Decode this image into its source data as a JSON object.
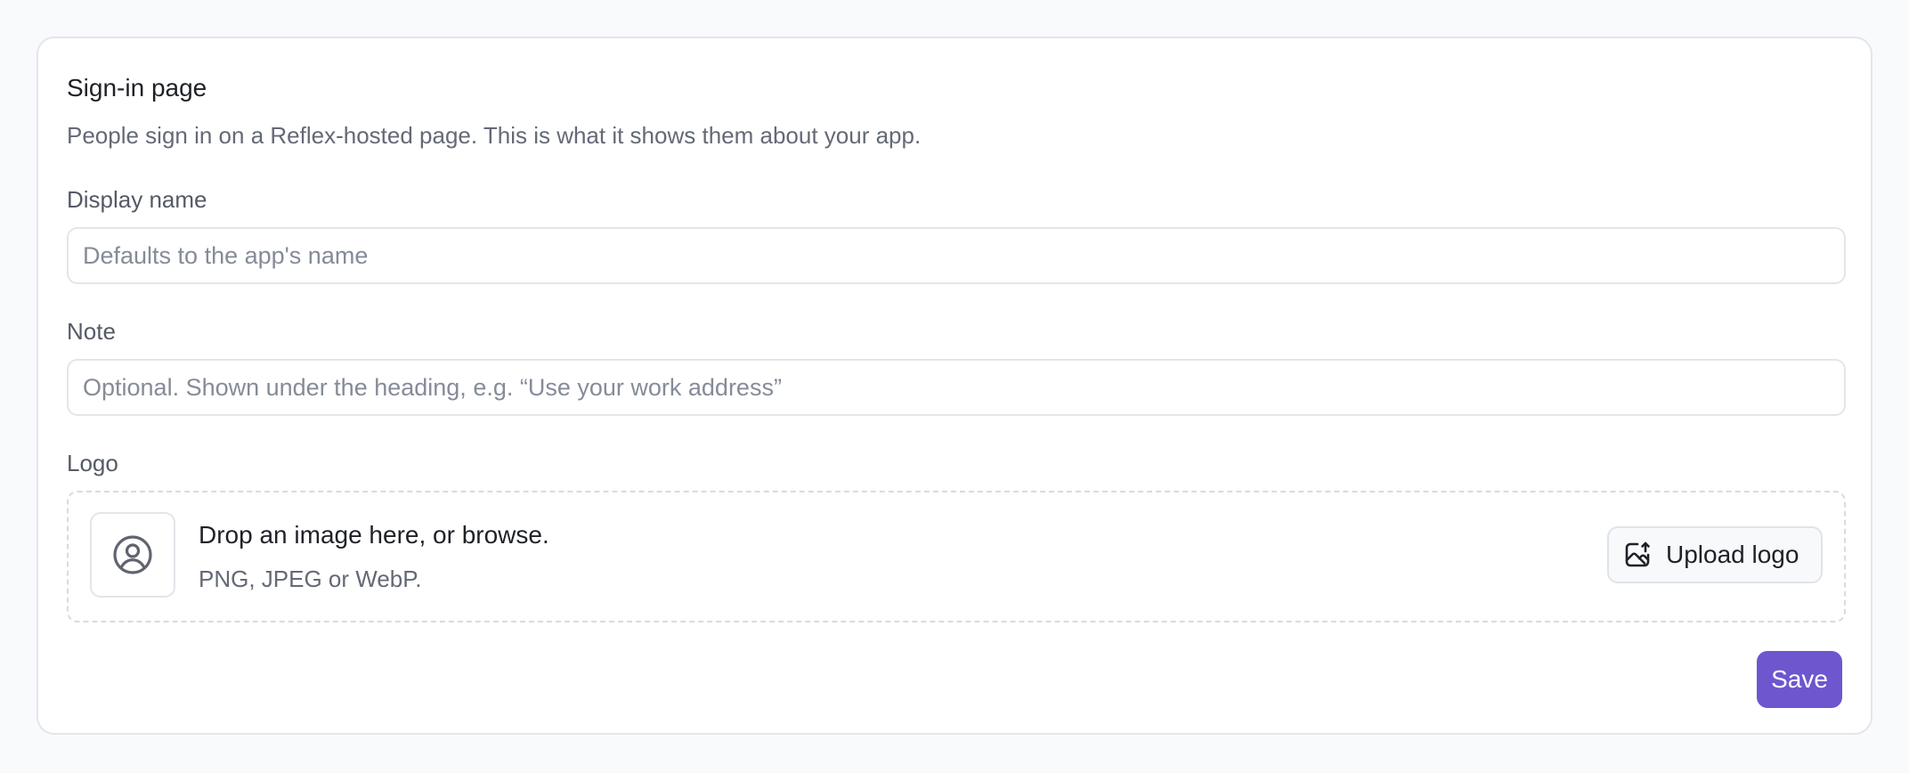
{
  "card": {
    "title": "Sign-in page",
    "description": "People sign in on a Reflex-hosted page. This is what it shows them about your app."
  },
  "display_name": {
    "label": "Display name",
    "value": "",
    "placeholder": "Defaults to the app's name"
  },
  "note": {
    "label": "Note",
    "value": "",
    "placeholder": "Optional. Shown under the heading, e.g. “Use your work address”"
  },
  "logo": {
    "label": "Logo",
    "drop_title": "Drop an image here, or browse.",
    "drop_subtitle": "PNG, JPEG or WebP.",
    "upload_label": "Upload logo",
    "placeholder_icon": "user-circle-icon",
    "upload_icon": "image-upload-icon"
  },
  "actions": {
    "save_label": "Save"
  },
  "colors": {
    "accent": "#6e56cf",
    "page_background": "#f9fafc",
    "border": "#e3e5ea"
  }
}
